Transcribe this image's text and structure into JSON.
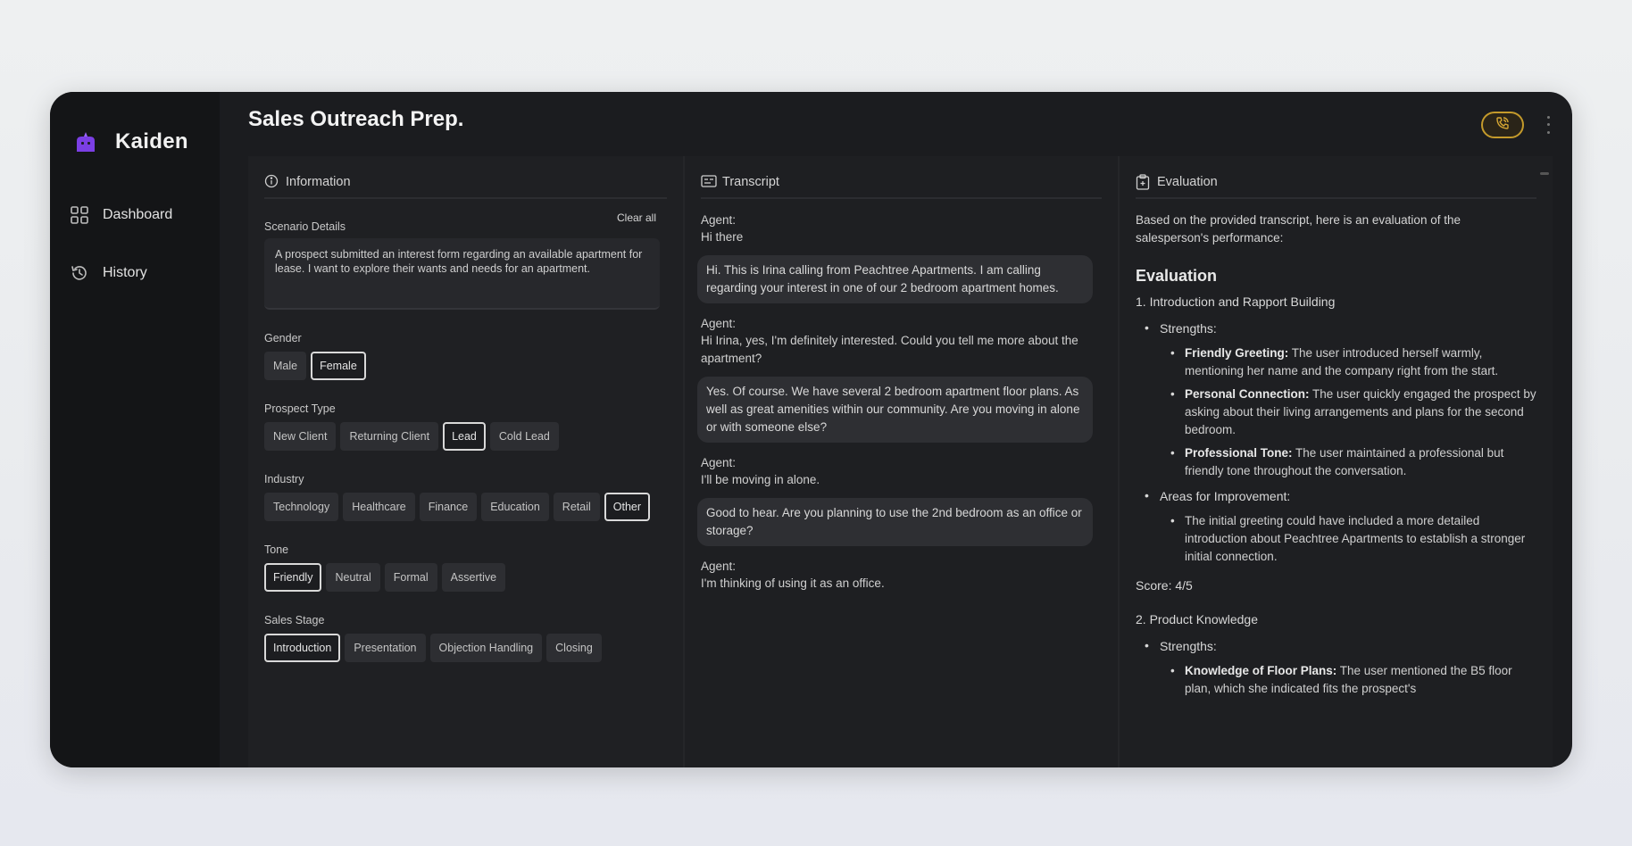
{
  "app": {
    "brand": "Kaiden"
  },
  "sidebar": {
    "items": [
      {
        "label": "Dashboard",
        "icon": "grid-icon"
      },
      {
        "label": "History",
        "icon": "history-icon"
      }
    ]
  },
  "header": {
    "title": "Sales Outreach Prep."
  },
  "info": {
    "title": "Information",
    "scenario_label": "Scenario Details",
    "clear_all": "Clear all",
    "scenario_text": "A prospect submitted an interest form regarding an available apartment for lease. I want to explore their wants and needs for an apartment.",
    "groups": [
      {
        "label": "Gender",
        "options": [
          "Male",
          "Female"
        ],
        "selected": "Female"
      },
      {
        "label": "Prospect Type",
        "options": [
          "New Client",
          "Returning Client",
          "Lead",
          "Cold Lead"
        ],
        "selected": "Lead"
      },
      {
        "label": "Industry",
        "options": [
          "Technology",
          "Healthcare",
          "Finance",
          "Education",
          "Retail",
          "Other"
        ],
        "selected": "Other"
      },
      {
        "label": "Tone",
        "options": [
          "Friendly",
          "Neutral",
          "Formal",
          "Assertive"
        ],
        "selected": "Friendly"
      },
      {
        "label": "Sales Stage",
        "options": [
          "Introduction",
          "Presentation",
          "Objection Handling",
          "Closing"
        ],
        "selected": "Introduction"
      }
    ]
  },
  "transcript": {
    "title": "Transcript",
    "messages": [
      {
        "type": "agent",
        "label": "Agent:",
        "text": "Hi there"
      },
      {
        "type": "user",
        "text": "Hi. This is Irina calling from Peachtree Apartments. I am calling regarding your interest in one of our 2 bedroom apartment homes."
      },
      {
        "type": "agent",
        "label": "Agent:",
        "text": "Hi Irina, yes, I'm definitely interested. Could you tell me more about the apartment?"
      },
      {
        "type": "user",
        "text": "Yes. Of course. We have several 2 bedroom apartment floor plans. As well as great amenities within our community. Are you moving in alone or with someone else?"
      },
      {
        "type": "agent",
        "label": "Agent:",
        "text": "I'll be moving in alone."
      },
      {
        "type": "user",
        "text": "Good to hear. Are you planning to use the 2nd bedroom as an office or storage?"
      },
      {
        "type": "agent",
        "label": "Agent:",
        "text": "I'm thinking of using it as an office."
      }
    ]
  },
  "evaluation": {
    "title": "Evaluation",
    "intro": "Based on the provided transcript, here is an evaluation of the salesperson's performance:",
    "heading": "Evaluation",
    "sections": [
      {
        "title": "1. Introduction and Rapport Building",
        "groups": [
          {
            "label": "Strengths:",
            "items": [
              {
                "bold": "Friendly Greeting:",
                "text": " The user introduced herself warmly, mentioning her name and the company right from the start."
              },
              {
                "bold": "Personal Connection:",
                "text": " The user quickly engaged the prospect by asking about their living arrangements and plans for the second bedroom."
              },
              {
                "bold": "Professional Tone:",
                "text": " The user maintained a professional but friendly tone throughout the conversation."
              }
            ]
          },
          {
            "label": "Areas for Improvement:",
            "items": [
              {
                "bold": "",
                "text": "The initial greeting could have included a more detailed introduction about Peachtree Apartments to establish a stronger initial connection."
              }
            ]
          }
        ],
        "score": "Score: 4/5"
      },
      {
        "title": "2. Product Knowledge",
        "groups": [
          {
            "label": "Strengths:",
            "items": [
              {
                "bold": "Knowledge of Floor Plans:",
                "text": " The user mentioned the B5 floor plan, which she indicated fits the prospect's"
              }
            ]
          }
        ],
        "score": ""
      }
    ]
  },
  "colors": {
    "accent": "#c49a2b",
    "brand": "#7b3fe4",
    "background": "#1b1c1f"
  }
}
